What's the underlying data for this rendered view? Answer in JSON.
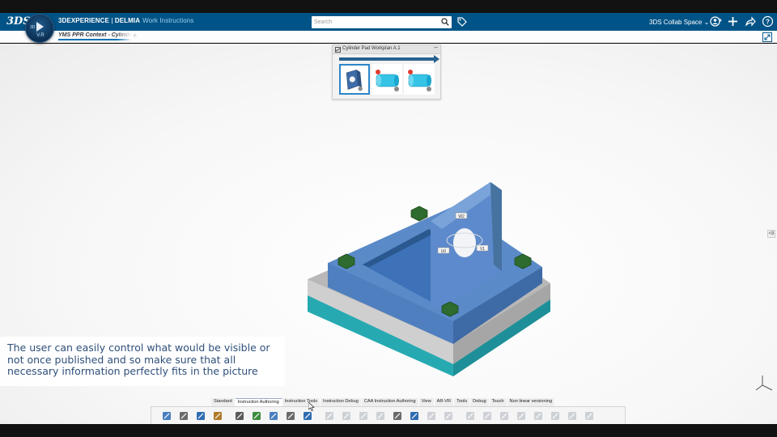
{
  "header": {
    "brand_logo": "3DS",
    "compass_label": "3D",
    "compass_version": "V.R",
    "app_brand_part1": "3DEXPERIENCE",
    "app_brand_sep": " | ",
    "app_brand_part2": "DELMIA",
    "app_name": "Work Instructions",
    "search_placeholder": "Search",
    "collab_space": "3DS Collab Space",
    "accent_color": "#005386"
  },
  "tabs": {
    "active_tab": "YMS PPR Context - Cylinder",
    "add_label": "+"
  },
  "workplan_panel": {
    "title": "Cylinder Pad Workplan A.1",
    "minimize_label": "–",
    "progress": 1.0,
    "thumbnails": [
      "plate-part",
      "cylinder-assembly-1",
      "cylinder-assembly-2"
    ]
  },
  "viewer": {
    "annotation_labels": [
      "W2",
      "U0",
      "V1"
    ],
    "side_handle": "<8"
  },
  "caption": {
    "text": "The user can easily control what would be visible or not once published and so make sure that all necessary information perfectly fits in the picture"
  },
  "section_tabs": [
    "Standard",
    "Instruction Authoring",
    "Instruction Tools",
    "Instruction Debug",
    "CAA Instruction Authoring",
    "View",
    "AR-VR",
    "Tools",
    "Debug",
    "Touch",
    "Non linear versioning"
  ],
  "active_section": "Instruction Authoring",
  "action_bar_icons": [
    "cut-icon",
    "copy-icon",
    "paste-icon",
    "undo-icon",
    "edit-instruction-icon",
    "search-instruction-icon",
    "validate-icon",
    "warning-icon",
    "capture-icon",
    "camera-icon",
    "camera-add-icon",
    "camera-delete-icon",
    "camera-view-icon",
    "annotation-icon",
    "arrow-icon",
    "pencil-icon",
    "frame-icon",
    "publish-icon",
    "settings-icon",
    "explode-icon",
    "layout-icon",
    "animate-icon",
    "sequence-icon",
    "part-icon",
    "align-icon"
  ]
}
